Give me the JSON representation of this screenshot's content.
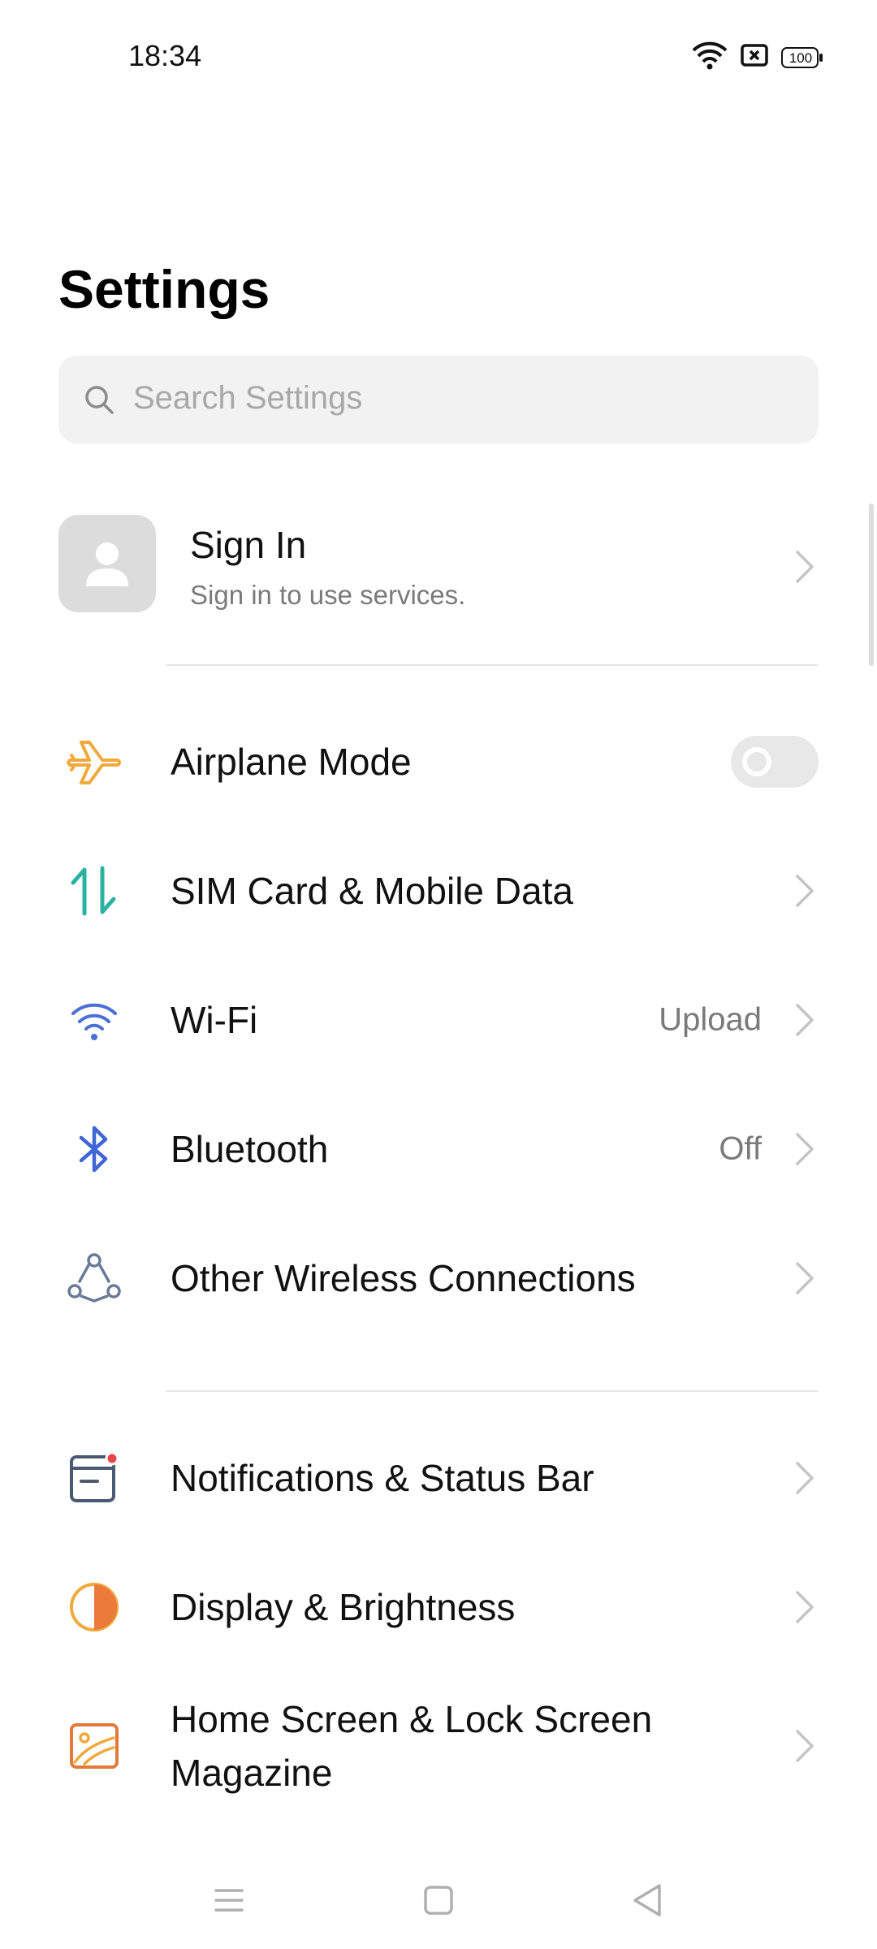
{
  "status_bar": {
    "time": "18:34",
    "battery_level": "100",
    "icons": [
      "wifi-icon",
      "sim-error-icon",
      "battery-icon"
    ]
  },
  "header": {
    "title": "Settings"
  },
  "search": {
    "placeholder": "Search Settings"
  },
  "account": {
    "title": "Sign In",
    "subtitle": "Sign in to use services."
  },
  "sections": {
    "connectivity": [
      {
        "label": "Airplane Mode",
        "icon": "airplane-icon",
        "control": "toggle",
        "toggle_on": false
      },
      {
        "label": "SIM Card & Mobile Data",
        "icon": "mobile-data-icon",
        "control": "chevron"
      },
      {
        "label": "Wi-Fi",
        "icon": "wifi-icon",
        "value": "Upload",
        "control": "chevron"
      },
      {
        "label": "Bluetooth",
        "icon": "bluetooth-icon",
        "value": "Off",
        "control": "chevron"
      },
      {
        "label": "Other Wireless Connections",
        "icon": "connections-icon",
        "control": "chevron"
      }
    ],
    "display": [
      {
        "label": "Notifications & Status Bar",
        "icon": "notifications-icon",
        "control": "chevron"
      },
      {
        "label": "Display & Brightness",
        "icon": "brightness-icon",
        "control": "chevron"
      },
      {
        "label": "Home Screen & Lock Screen Magazine",
        "icon": "wallpaper-icon",
        "control": "chevron"
      }
    ]
  },
  "nav_bar": {
    "buttons": [
      "menu-icon",
      "home-icon",
      "back-icon"
    ]
  },
  "colors": {
    "airplane": "#f0a93b",
    "mobile_data": "#2bb3a0",
    "wifi": "#4a6fd6",
    "bluetooth": "#3f66d4",
    "connections": "#6b7a99",
    "notifications": "#4b5a73",
    "notification_dot": "#e8454a",
    "brightness": "#f0a93b",
    "wallpaper": "#e27a3a",
    "chevron": "#c4c4c4"
  }
}
